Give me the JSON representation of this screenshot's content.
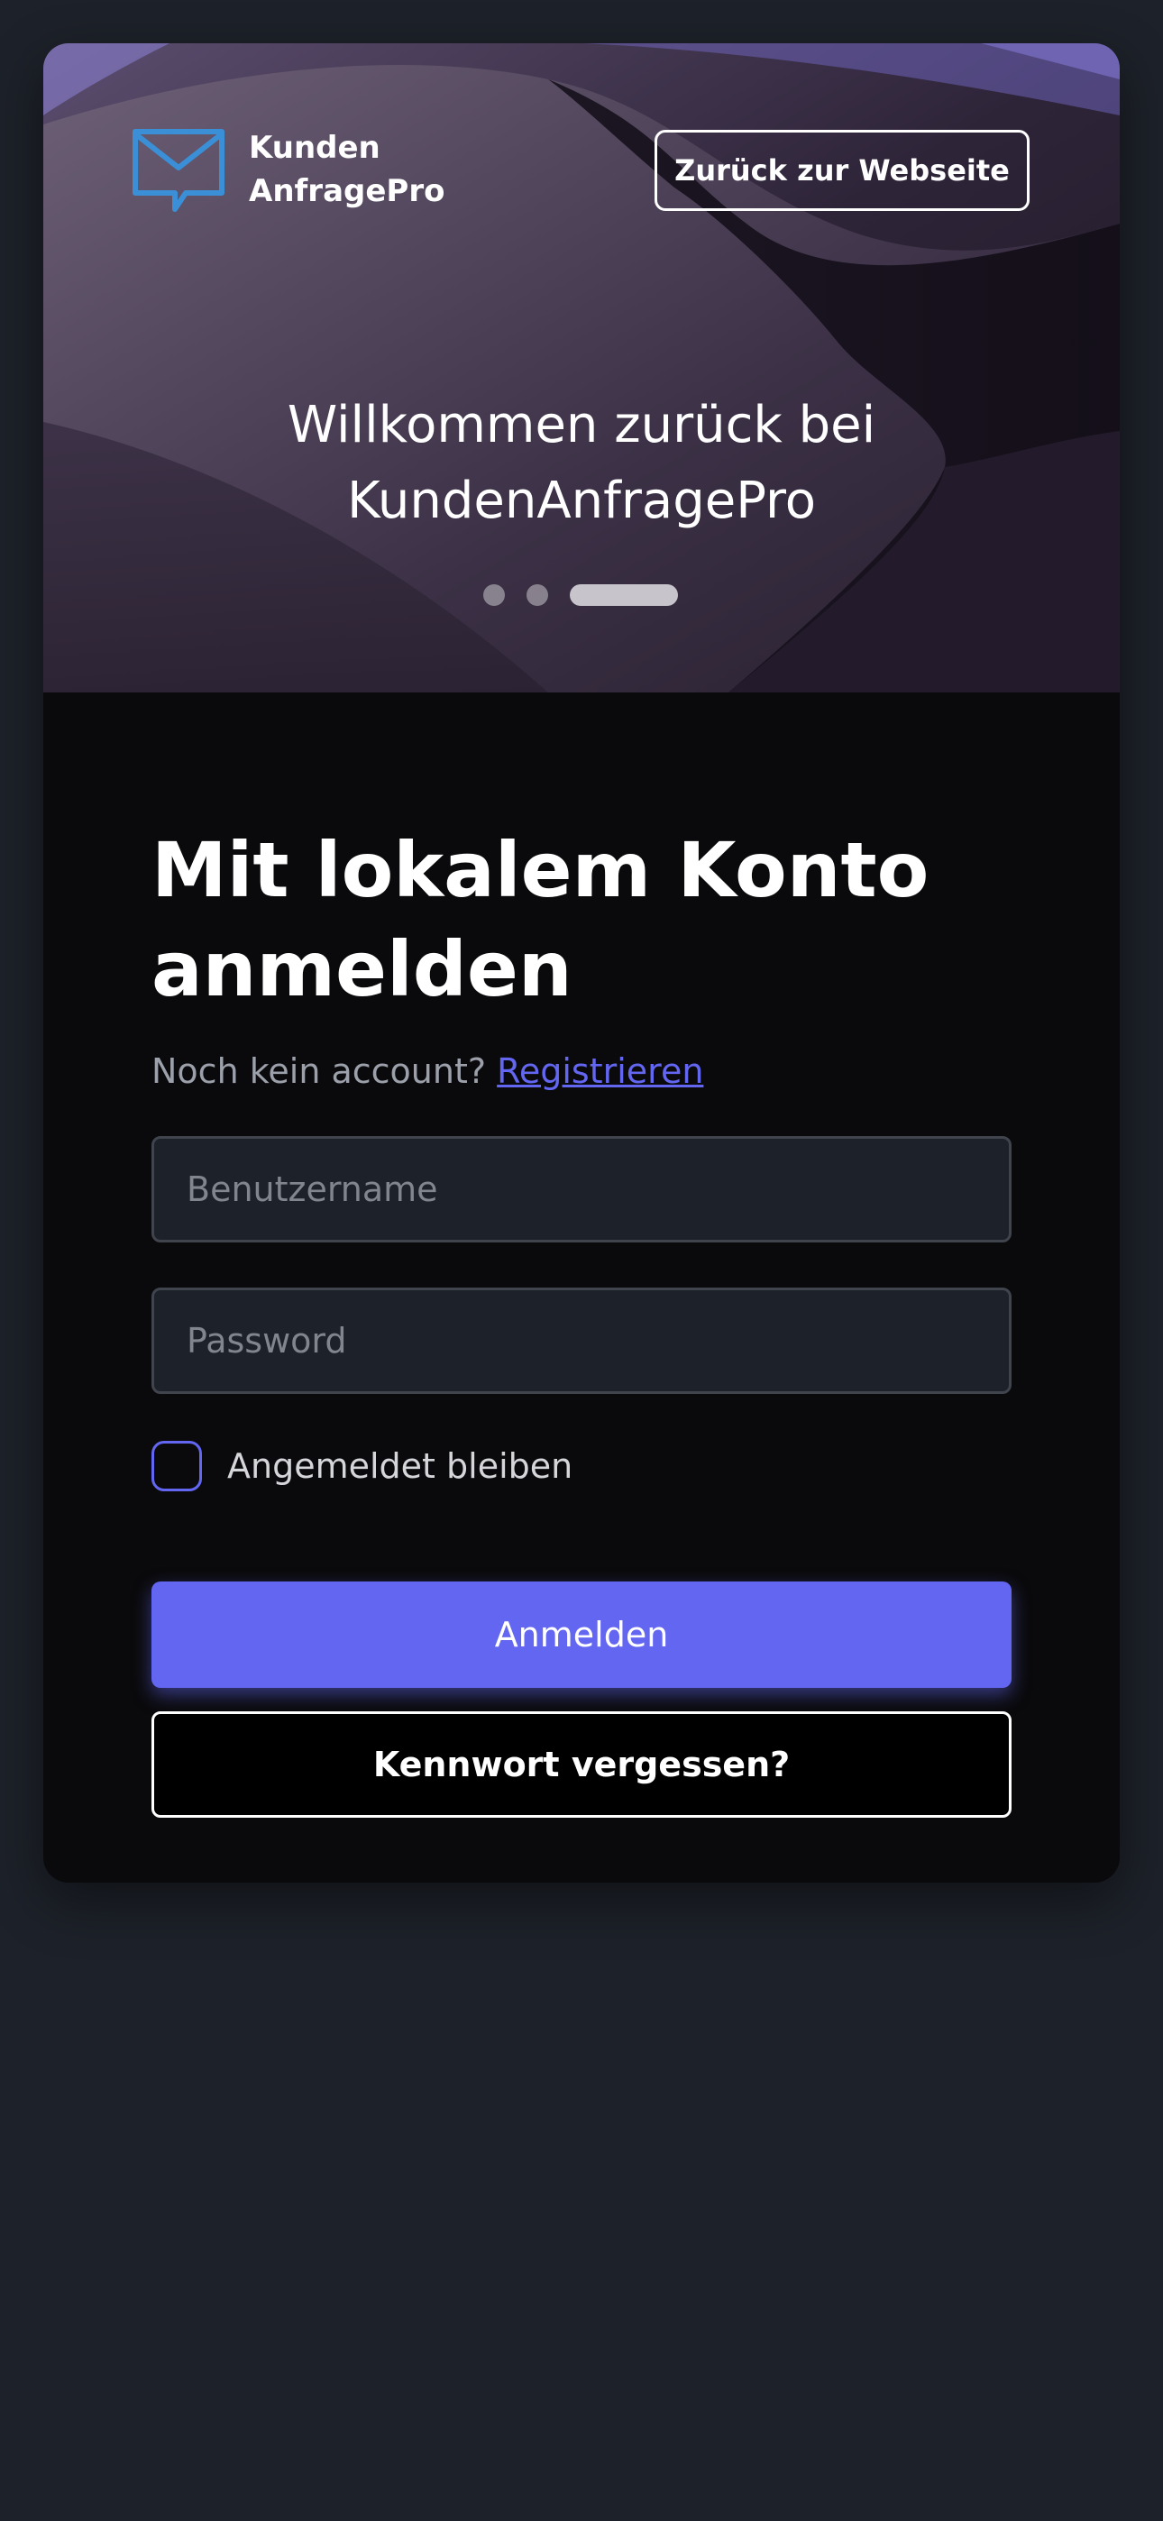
{
  "app": {
    "brand_line1": "Kunden",
    "brand_line2": "AnfragePro",
    "logo_icon": "mail-chat-icon",
    "accent_color": "#6366f1",
    "logo_color": "#3b8fd6"
  },
  "hero": {
    "back_button_label": "Zurück zur Webseite",
    "welcome_line1": "Willkommen zurück bei",
    "welcome_line2": "KundenAnfragePro",
    "carousel": {
      "slide_count": 3,
      "active_slide": 3
    }
  },
  "login": {
    "heading_line1": "Mit lokalem Konto",
    "heading_line2": "anmelden",
    "no_account_text": "Noch kein account?",
    "register_link": "Registrieren",
    "username_placeholder": "Benutzername",
    "username_value": "",
    "password_placeholder": "Password",
    "password_value": "",
    "remember_label": "Angemeldet bleiben",
    "remember_checked": false,
    "submit_label": "Anmelden",
    "forgot_label": "Kennwort vergessen?"
  }
}
